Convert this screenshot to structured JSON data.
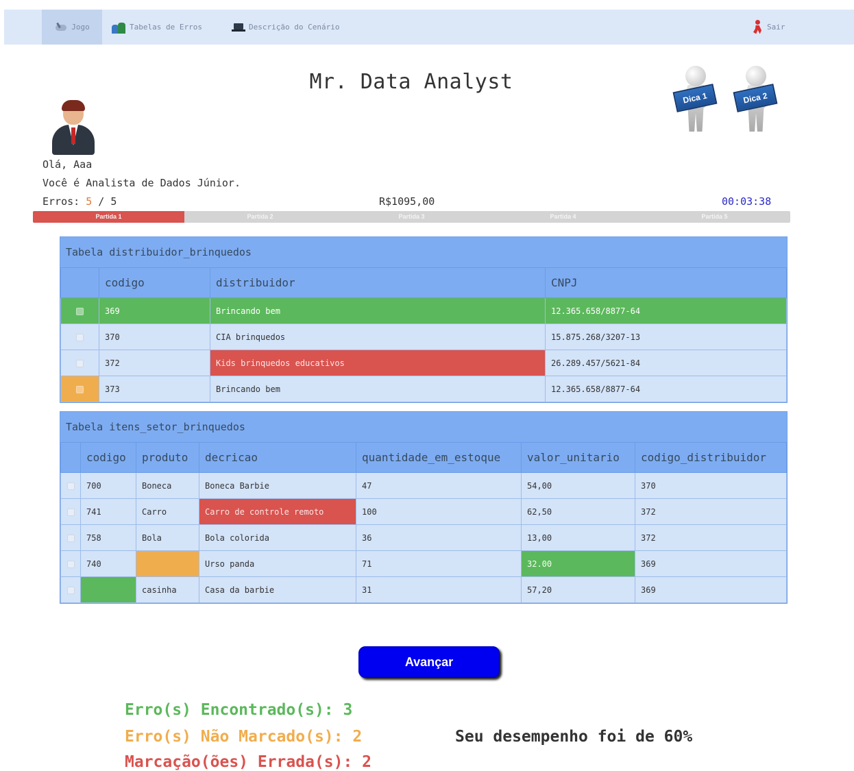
{
  "nav": {
    "items": [
      {
        "label": "Jogo",
        "icon": "joystick-icon",
        "active": true
      },
      {
        "label": "Tabelas de Erros",
        "icon": "people-icon"
      },
      {
        "label": "Descrição do Cenário",
        "icon": "laptop-icon"
      }
    ],
    "logout": {
      "label": "Sair",
      "icon": "exit-icon"
    }
  },
  "title": "Mr. Data Analyst",
  "hints": [
    {
      "label": "Dica 1"
    },
    {
      "label": "Dica 2"
    }
  ],
  "player": {
    "greeting": "Olá, Aaa",
    "role": "Você é Analista de Dados Júnior.",
    "errors_label": "Erros:",
    "errors_current": "5",
    "errors_separator": "/",
    "errors_total": "5"
  },
  "money": "R$1095,00",
  "timer": "00:03:38",
  "rounds": [
    "Partida 1",
    "Partida 2",
    "Partida 3",
    "Partida 4",
    "Partida 5"
  ],
  "colors": {
    "green": "#5cb85c",
    "red": "#d9534f",
    "orange": "#f0ad4e",
    "blue_button": "#0000f0",
    "header_blue": "#7eacf2"
  },
  "table1": {
    "title": "Tabela distribuidor_brinquedos",
    "columns": [
      "codigo",
      "distribuidor",
      "CNPJ"
    ],
    "rows": [
      [
        "369",
        "Brincando bem",
        "12.365.658/8877-64"
      ],
      [
        "370",
        "CIA brinquedos",
        "15.875.268/3207-13"
      ],
      [
        "372",
        "Kids brinquedos educativos",
        "26.289.457/5621-84"
      ],
      [
        "373",
        "Brincando bem",
        "12.365.658/8877-64"
      ]
    ]
  },
  "table2": {
    "title": "Tabela itens_setor_brinquedos",
    "columns": [
      "codigo",
      "produto",
      "decricao",
      "quantidade_em_estoque",
      "valor_unitario",
      "codigo_distribuidor"
    ],
    "rows": [
      [
        "700",
        "Boneca",
        "Boneca Barbie",
        "47",
        "54,00",
        "370"
      ],
      [
        "741",
        "Carro",
        "Carro de controle remoto",
        "100",
        "62,50",
        "372"
      ],
      [
        "758",
        "Bola",
        "Bola colorida",
        "36",
        "13,00",
        "372"
      ],
      [
        "740",
        "",
        "Urso panda",
        "71",
        "32.00",
        "369"
      ],
      [
        "",
        "casinha",
        "Casa da barbie",
        "31",
        "57,20",
        "369"
      ]
    ]
  },
  "advance_button": "Avançar",
  "results": {
    "found": "Erro(s) Encontrado(s): 3",
    "not_marked": "Erro(s) Não Marcado(s): 2",
    "wrong": "Marcação(ões) Errada(s): 2",
    "performance": "Seu desempenho foi de 60%"
  }
}
